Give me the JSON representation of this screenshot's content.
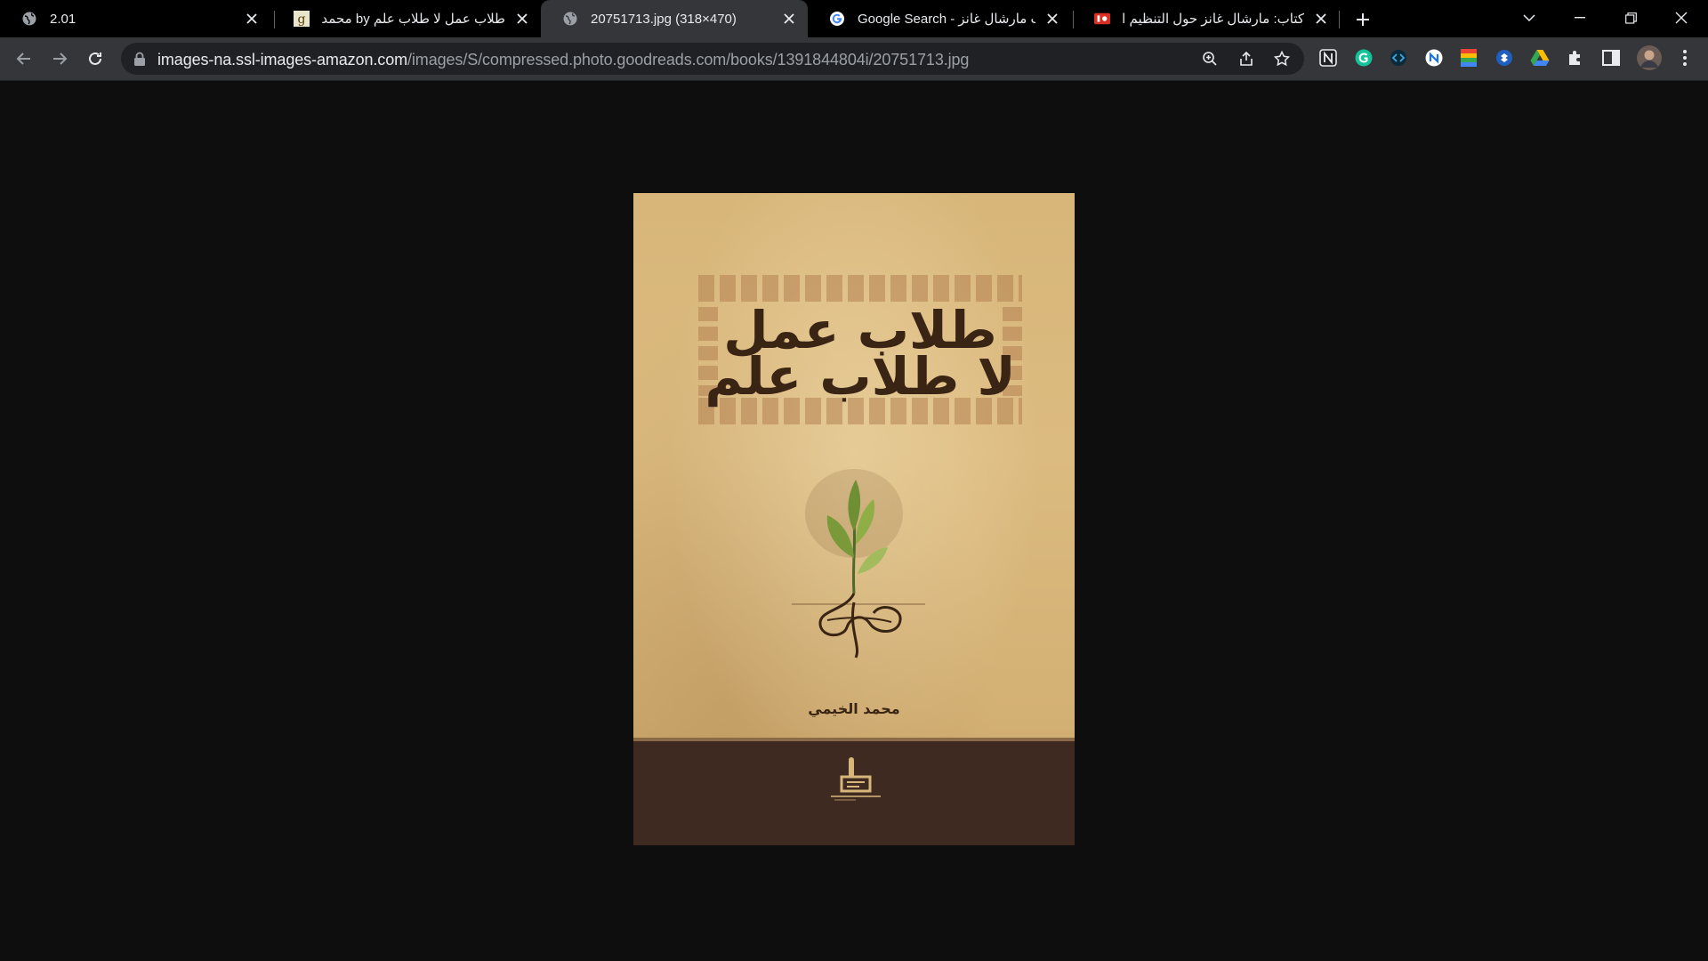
{
  "tabs": [
    {
      "title": "2.01",
      "favicon": "globe-icon",
      "active": false
    },
    {
      "title": "طلاب عمل لا طلاب علم by محمد ال",
      "favicon": "goodreads-g-icon",
      "active": false
    },
    {
      "title": "20751713.jpg (318×470)",
      "favicon": "globe-icon",
      "active": true
    },
    {
      "title": "Google Search - كتاب مارشال غانز",
      "favicon": "google-icon",
      "active": false
    },
    {
      "title": "كتاب: مارشال غانز حول التنظيم الم",
      "favicon": "book-red-icon",
      "active": false
    }
  ],
  "address_bar": {
    "host": "images-na.ssl-images-amazon.com",
    "path": "/images/S/compressed.photo.goodreads.com/books/1391844804i/20751713.jpg"
  },
  "extensions": [
    "notion-icon",
    "grammarly-icon",
    "code-ext-icon",
    "ext-n-icon",
    "stack-ext-icon",
    "dropbox-ext-icon",
    "drive-icon",
    "puzzle-icon",
    "sidepanel-icon",
    "profile-avatar",
    "menu-dots-icon"
  ],
  "cover": {
    "title_line_1": "طلاب عمل",
    "title_line_2": "لا طلاب علم",
    "author": "محمد الخيمي"
  },
  "colors": {
    "tab_strip": "#000000",
    "toolbar": "#35363a",
    "omnibox": "#202124",
    "viewer_bg": "#0e0e0e",
    "cover_paper": "#d8b67a",
    "cover_band": "#3e2a20"
  }
}
